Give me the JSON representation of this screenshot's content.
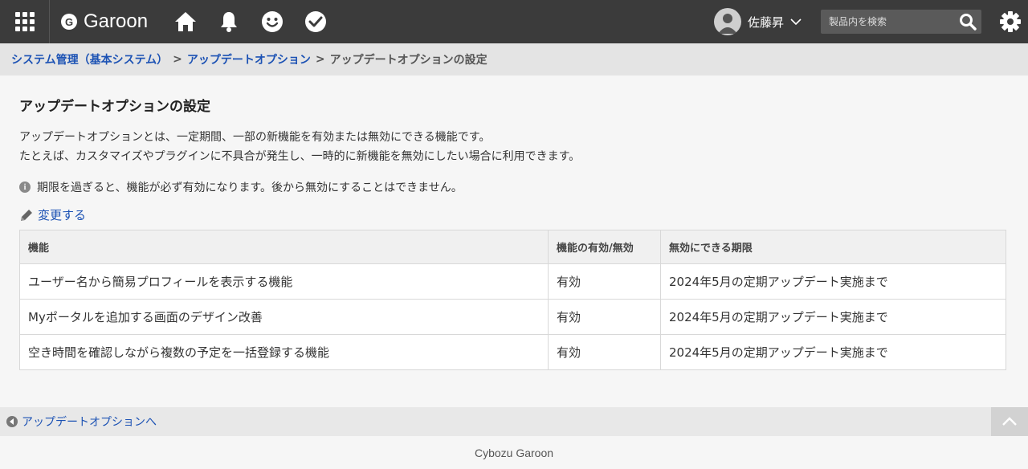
{
  "header": {
    "logo_mark": "G",
    "logo_text": "Garoon",
    "user_name": "佐藤昇",
    "search_placeholder": "製品内を検索"
  },
  "breadcrumb": {
    "items": [
      "システム管理（基本システム）",
      "アップデートオプション"
    ],
    "separator": ">",
    "current": "アップデートオプションの設定"
  },
  "main": {
    "title": "アップデートオプションの設定",
    "description": [
      "アップデートオプションとは、一定期間、一部の新機能を有効または無効にできる機能です。",
      "たとえば、カスタマイズやプラグインに不具合が発生し、一時的に新機能を無効にしたい場合に利用できます。"
    ],
    "notice": "期限を過ぎると、機能が必ず有効になります。後から無効にすることはできません。",
    "info_glyph": "i",
    "change_link": "変更する"
  },
  "table": {
    "headers": [
      "機能",
      "機能の有効/無効",
      "無効にできる期限"
    ],
    "rows": [
      {
        "feature": "ユーザー名から簡易プロフィールを表示する機能",
        "status": "有効",
        "deadline": "2024年5月の定期アップデート実施まで"
      },
      {
        "feature": "Myポータルを追加する画面のデザイン改善",
        "status": "有効",
        "deadline": "2024年5月の定期アップデート実施まで"
      },
      {
        "feature": "空き時間を確認しながら複数の予定を一括登録する機能",
        "status": "有効",
        "deadline": "2024年5月の定期アップデート実施まで"
      }
    ]
  },
  "footer": {
    "back_link": "アップデートオプションへ",
    "copyright": "Cybozu Garoon"
  },
  "colors": {
    "header_bg": "#3b3b3b",
    "link": "#1c52b4",
    "status_enabled": "#2e8b1e"
  }
}
